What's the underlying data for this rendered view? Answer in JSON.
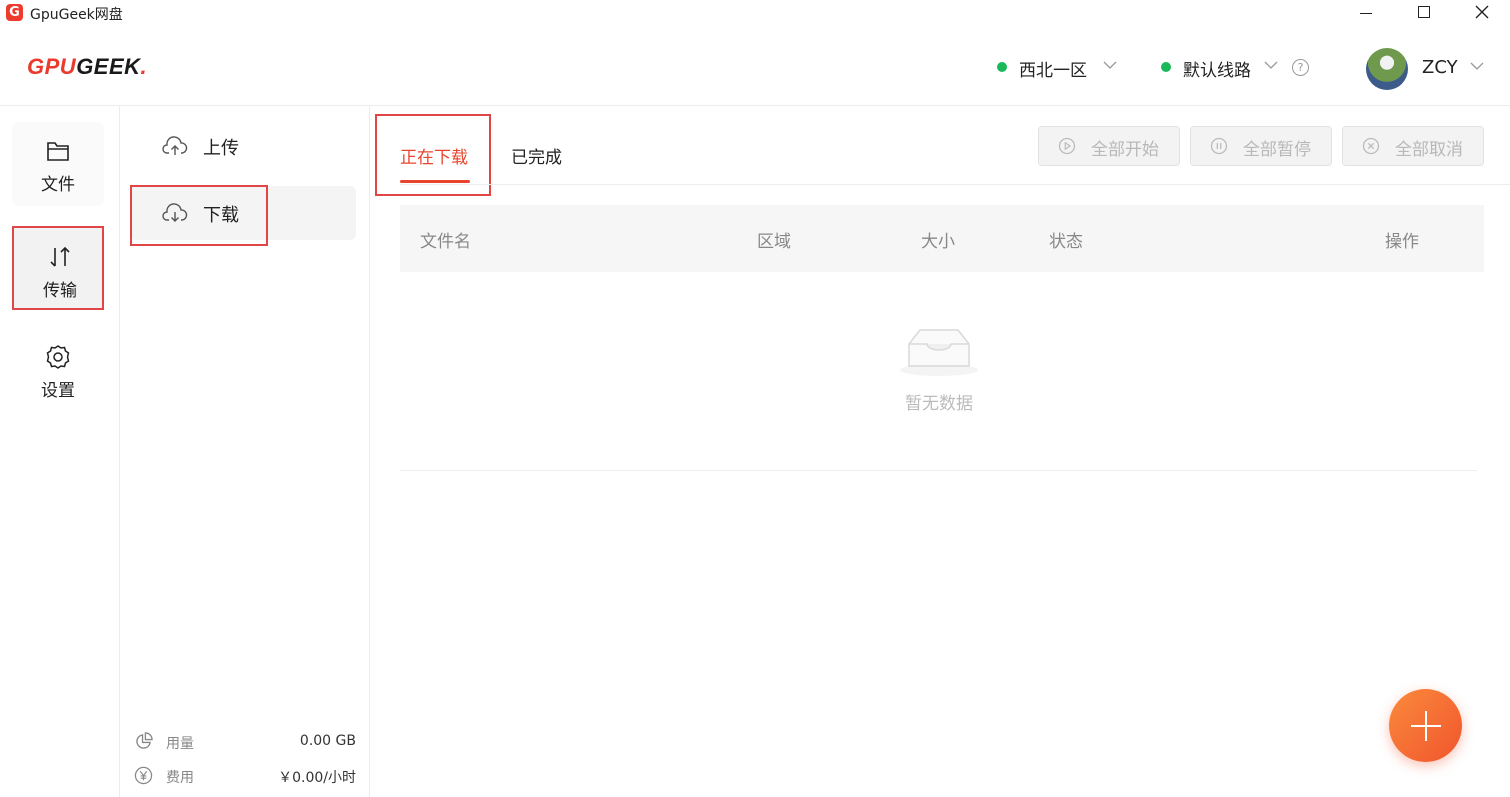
{
  "window": {
    "title": "GpuGeek网盘",
    "app_icon_letter": "G"
  },
  "header": {
    "logo": {
      "part1": "GPU",
      "part2": "GEEK",
      "part3": "."
    },
    "region": "西北一区",
    "route": "默认线路",
    "user": "ZCY",
    "status_color": "#19b95a"
  },
  "leftnav": {
    "items": [
      {
        "label": "文件",
        "icon": "folder-icon"
      },
      {
        "label": "传输",
        "icon": "transfer-icon"
      },
      {
        "label": "设置",
        "icon": "gear-icon"
      }
    ]
  },
  "subnav": {
    "items": [
      {
        "label": "上传",
        "icon": "cloud-upload-icon"
      },
      {
        "label": "下载",
        "icon": "cloud-download-icon"
      }
    ],
    "usage": {
      "label": "用量",
      "value": "0.00 GB"
    },
    "cost": {
      "label": "费用",
      "value": "￥0.00/小时"
    }
  },
  "main": {
    "tabs": [
      {
        "label": "正在下载"
      },
      {
        "label": "已完成"
      }
    ],
    "actions": {
      "start": "全部开始",
      "pause": "全部暂停",
      "cancel": "全部取消"
    },
    "table": {
      "columns": [
        "文件名",
        "区域",
        "大小",
        "状态",
        "操作"
      ],
      "rows": [],
      "empty_text": "暂无数据"
    },
    "accent": "#e8452e"
  }
}
